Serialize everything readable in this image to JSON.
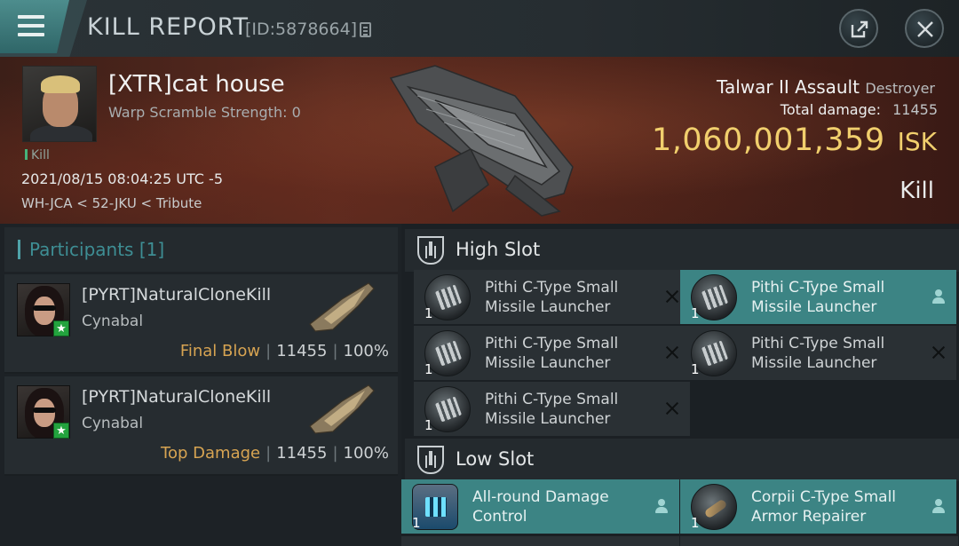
{
  "titlebar": {
    "title": "KILL REPORT",
    "report_id": "[ID:5878664]",
    "icons": [
      "menu-icon",
      "copy-icon",
      "share-icon",
      "close-icon"
    ]
  },
  "victim": {
    "name": "[XTR]cat house",
    "warp_scramble": "Warp Scramble Strength: 0",
    "kill_tag": "Kill",
    "datetime": "2021/08/15 08:04:25 UTC -5",
    "location": "WH-JCA < 52-JKU < Tribute"
  },
  "ship": {
    "name": "Talwar II Assault",
    "class": "Destroyer",
    "total_damage_label": "Total damage:",
    "total_damage": "11455",
    "isk_value": "1,060,001,359",
    "isk_unit": "ISK",
    "result": "Kill"
  },
  "participants": {
    "header": "Participants [1]",
    "items": [
      {
        "name": "[PYRT]NaturalCloneKill",
        "ship": "Cynabal",
        "role": "Final Blow",
        "damage": "11455",
        "percent": "100%"
      },
      {
        "name": "[PYRT]NaturalCloneKill",
        "ship": "Cynabal",
        "role": "Top Damage",
        "damage": "11455",
        "percent": "100%"
      }
    ]
  },
  "fitting": {
    "high_slot_label": "High Slot",
    "low_slot_label": "Low Slot",
    "high": [
      {
        "qty": "1",
        "name": "Pithi C-Type Small Missile Launcher",
        "status": "destroyed"
      },
      {
        "qty": "1",
        "name": "Pithi C-Type Small Missile Launcher",
        "status": "dropped"
      },
      {
        "qty": "1",
        "name": "Pithi C-Type Small Missile Launcher",
        "status": "destroyed"
      },
      {
        "qty": "1",
        "name": "Pithi C-Type Small Missile Launcher",
        "status": "destroyed"
      },
      {
        "qty": "1",
        "name": "Pithi C-Type Small Missile Launcher",
        "status": "destroyed"
      }
    ],
    "low": [
      {
        "qty": "1",
        "name": "All-round Damage Control",
        "status": "dropped"
      },
      {
        "qty": "1",
        "name": "Corpii C-Type Small Armor Repairer",
        "status": "dropped"
      }
    ]
  },
  "colors": {
    "accent_teal": "#3c8484",
    "isk_gold": "#f1cf6d",
    "final_blow": "#d7a452"
  }
}
